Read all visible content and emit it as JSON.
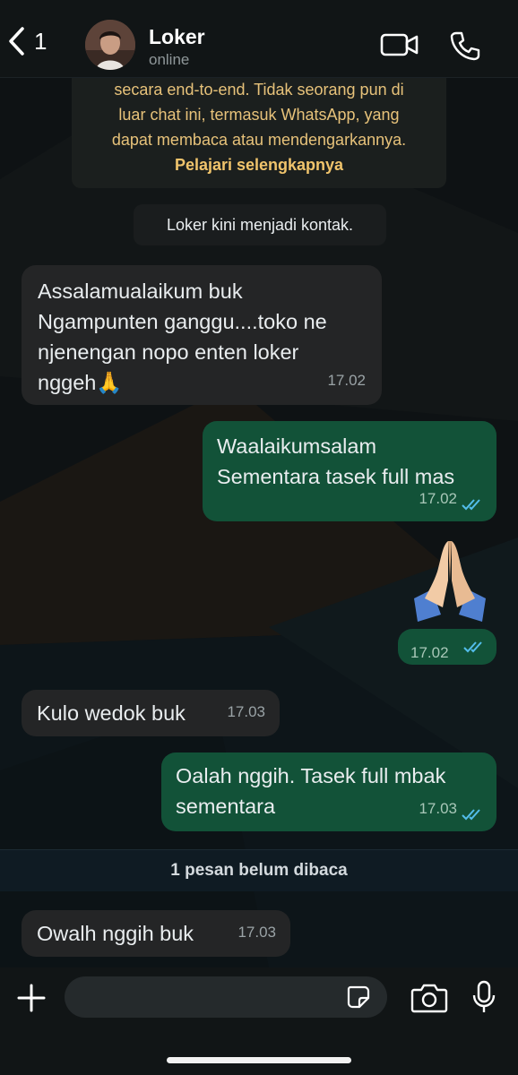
{
  "header": {
    "back_count": "1",
    "contact_name": "Loker",
    "status": "online"
  },
  "encryption_notice": {
    "text": "secara end-to-end. Tidak seorang pun di\nluar chat ini, termasuk WhatsApp, yang\ndapat membaca atau mendengarkannya.",
    "link": "Pelajari selengkapnya"
  },
  "system_message": "Loker kini menjadi kontak.",
  "messages": [
    {
      "direction": "in",
      "text": "Assalamualaikum buk\nNgampunten ganggu....toko ne\nnjenengan nopo enten loker\nnggeh🙏",
      "time": "17.02"
    },
    {
      "direction": "out",
      "text": "Waalaikumsalam\nSementara tasek full mas",
      "time": "17.02"
    },
    {
      "direction": "out",
      "text": "🙏🏻",
      "time": "17.02"
    },
    {
      "direction": "in",
      "text": "Kulo wedok buk",
      "time": "17.03"
    },
    {
      "direction": "out",
      "text": "Oalah nggih. Tasek full mbak\nsementara",
      "time": "17.03"
    },
    {
      "direction": "in",
      "text": "Owalh nggih buk",
      "time": "17.03"
    }
  ],
  "unread_banner": "1 pesan belum dibaca",
  "composer": {
    "placeholder": ""
  },
  "colors": {
    "header_bg": "#111516",
    "incoming_bubble": "#242526",
    "outgoing_bubble": "#125238",
    "encryption_text": "#e7c27a",
    "read_ticks": "#53bdeb"
  }
}
